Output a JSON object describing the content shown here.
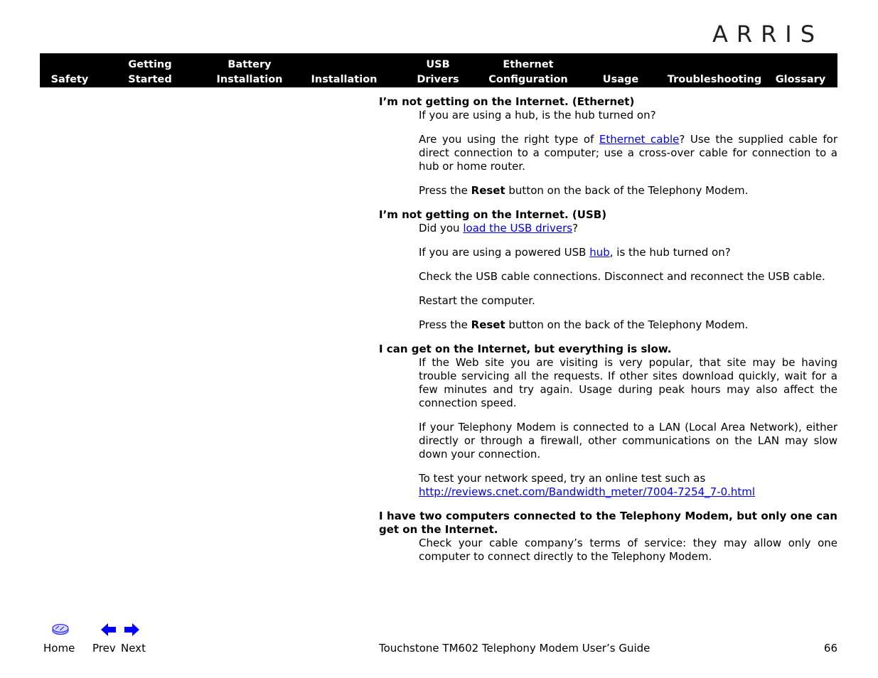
{
  "brand": {
    "logo_text": "ARRIS"
  },
  "nav": {
    "items": [
      {
        "line1": "",
        "line2": "Safety"
      },
      {
        "line1": "Getting",
        "line2": "Started"
      },
      {
        "line1": "Battery",
        "line2": "Installation"
      },
      {
        "line1": "",
        "line2": "Installation"
      },
      {
        "line1": "USB",
        "line2": "Drivers"
      },
      {
        "line1": "Ethernet",
        "line2": "Configuration"
      },
      {
        "line1": "",
        "line2": "Usage"
      },
      {
        "line1": "",
        "line2": "Troubleshooting"
      },
      {
        "line1": "",
        "line2": "Glossary"
      }
    ]
  },
  "sections": [
    {
      "question": "I’m not getting on the Internet. (Ethernet)",
      "answers": [
        {
          "text": "If you are using a hub, is the hub turned on?"
        },
        {
          "pre": "Are you using the right type of ",
          "link": "Ethernet cable",
          "post": "? Use the supplied cable for direct connection to a computer; use a cross-over cable for connection to a hub or home router."
        },
        {
          "pre": "Press the ",
          "bold": "Reset",
          "post": " button on the back of the Telephony Modem."
        }
      ]
    },
    {
      "question": "I’m not getting on the Internet. (USB)",
      "answers": [
        {
          "pre": "Did you ",
          "link": "load the USB drivers",
          "post": "?"
        },
        {
          "pre": "If you are using a powered USB ",
          "link": "hub",
          "post": ", is the hub turned on?"
        },
        {
          "text": "Check the USB cable connections. Disconnect and reconnect the USB cable."
        },
        {
          "text": "Restart the computer."
        },
        {
          "pre": "Press the ",
          "bold": "Reset",
          "post": " button on the back of the Telephony Modem."
        }
      ]
    },
    {
      "question": "I can get on the Internet, but everything is slow.",
      "answers": [
        {
          "text": "If the Web site you are visiting is very popular, that site may be having trouble servicing all the requests. If other sites download quickly, wait for a few minutes and try again. Usage during peak hours may also affect the connection speed."
        },
        {
          "text": "If your Telephony Modem is connected to a LAN (Local Area Network), either directly or through a firewall, other communications on the LAN may slow down your connection."
        },
        {
          "pre": "To test your network speed, try an online test such as",
          "link": "http://reviews.cnet.com/Bandwidth_meter/7004-7254_7-0.html",
          "post": "",
          "break_before_link": true
        }
      ]
    },
    {
      "question": "I have two computers connected to the Telephony Modem, but only one can get on the Internet.",
      "answers": [
        {
          "text": "Check your cable company’s terms of service: they may allow only one computer to connect directly to the Telephony Modem."
        }
      ]
    }
  ],
  "footer": {
    "home_label": "Home",
    "prev_label": "Prev",
    "next_label": "Next",
    "guide_title": "Touchstone TM602 Telephony Modem User’s Guide",
    "page_number": "66"
  },
  "colors": {
    "nav_bg": "#000000",
    "link": "#0000ee",
    "icon_blue": "#0000ff"
  }
}
